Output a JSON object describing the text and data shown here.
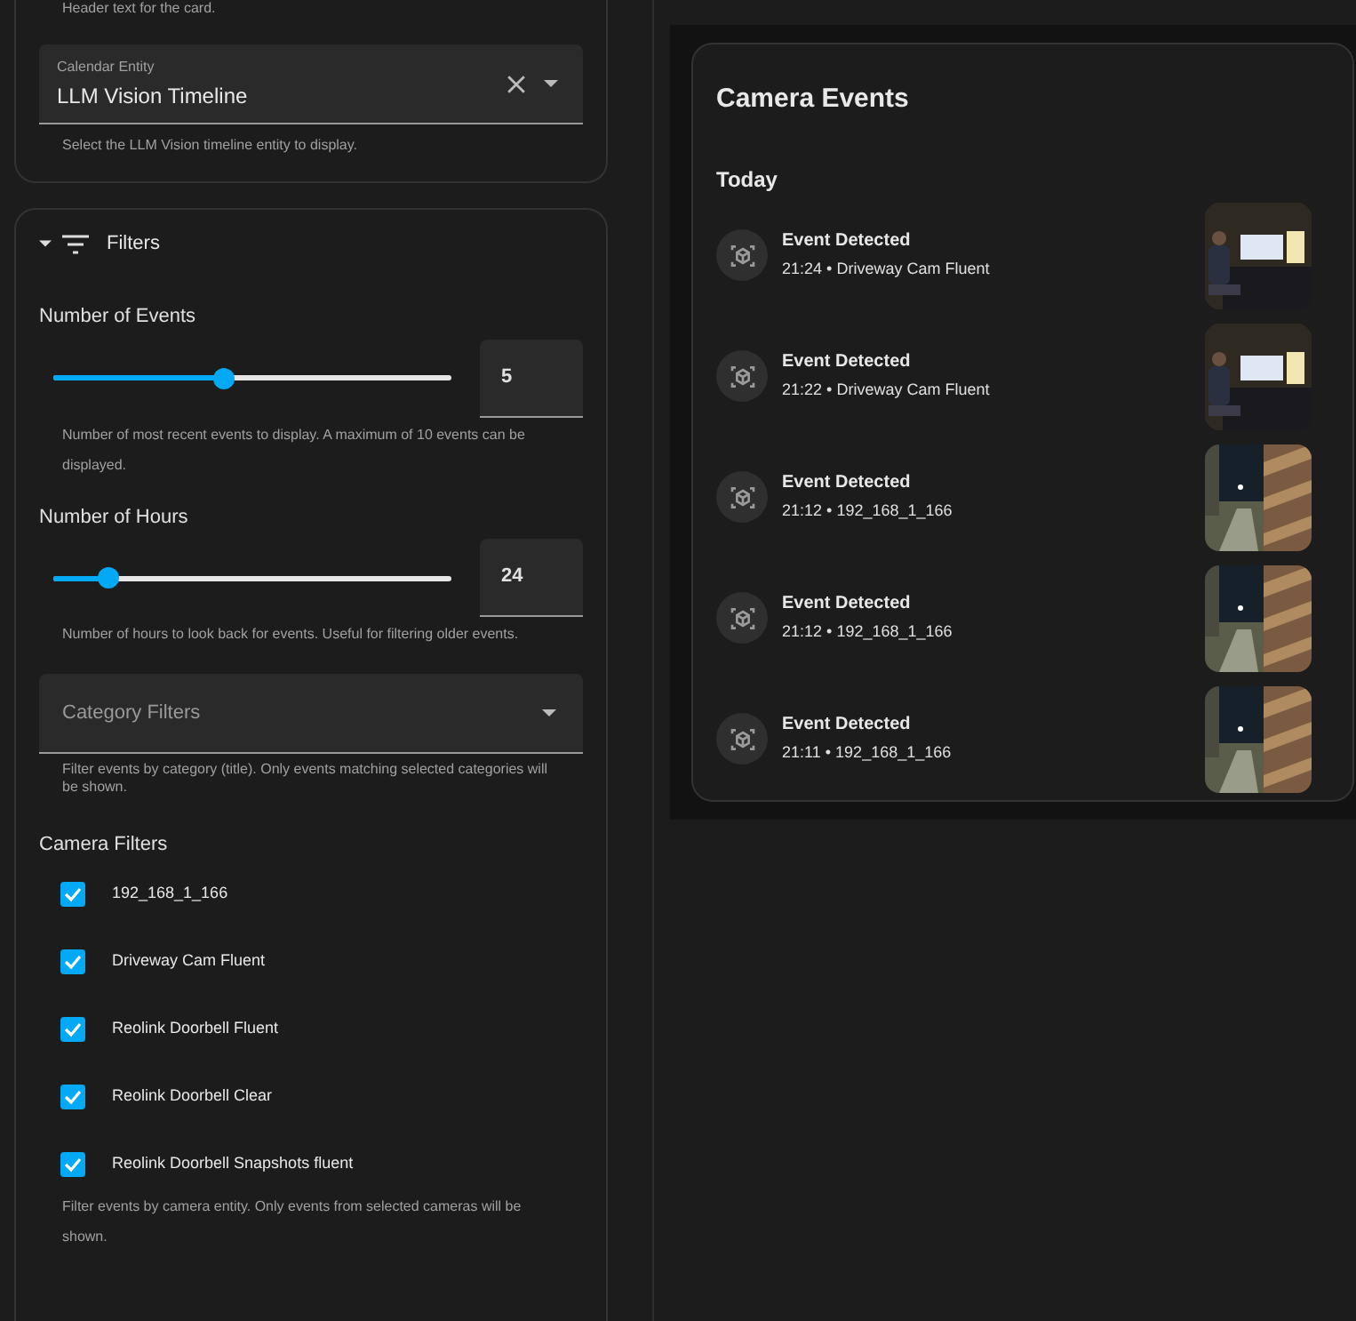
{
  "general": {
    "header_hint": "Header text for the card.",
    "calendar_entity": {
      "label": "Calendar Entity",
      "value": "LLM Vision Timeline",
      "hint": "Select the LLM Vision timeline entity to display."
    }
  },
  "filters": {
    "title": "Filters",
    "expanded": true,
    "sliders": [
      {
        "label": "Number of Events",
        "level": 0.44,
        "value": "5",
        "hint": "Number of most recent events to display. A maximum of 10 events can be displayed."
      },
      {
        "label": "Number of Hours",
        "level": 0.14,
        "value": "24",
        "hint": "Number of hours to look back for events. Useful for filtering older events."
      }
    ],
    "category": {
      "placeholder": "Category Filters",
      "hint": "Filter events by category (title). Only events matching selected categories will be shown."
    },
    "camera_filters": {
      "title": "Camera Filters",
      "items": [
        {
          "label": "192_168_1_166",
          "checked": true
        },
        {
          "label": "Driveway Cam Fluent",
          "checked": true
        },
        {
          "label": "Reolink Doorbell Fluent",
          "checked": true
        },
        {
          "label": "Reolink Doorbell Clear",
          "checked": true
        },
        {
          "label": "Reolink Doorbell Snapshots fluent",
          "checked": true
        }
      ],
      "hint": "Filter events by camera entity. Only events from selected cameras will be shown."
    }
  },
  "preview": {
    "title": "Camera Events",
    "day": "Today",
    "events": [
      {
        "title": "Event Detected",
        "time": "21:24",
        "camera": "Driveway Cam Fluent",
        "separator": "•"
      },
      {
        "title": "Event Detected",
        "time": "21:22",
        "camera": "Driveway Cam Fluent",
        "separator": "•"
      },
      {
        "title": "Event Detected",
        "time": "21:12",
        "camera": "192_168_1_166",
        "separator": "•"
      },
      {
        "title": "Event Detected",
        "time": "21:12",
        "camera": "192_168_1_166",
        "separator": "•"
      },
      {
        "title": "Event Detected",
        "time": "21:11",
        "camera": "192_168_1_166",
        "separator": "•"
      }
    ]
  }
}
